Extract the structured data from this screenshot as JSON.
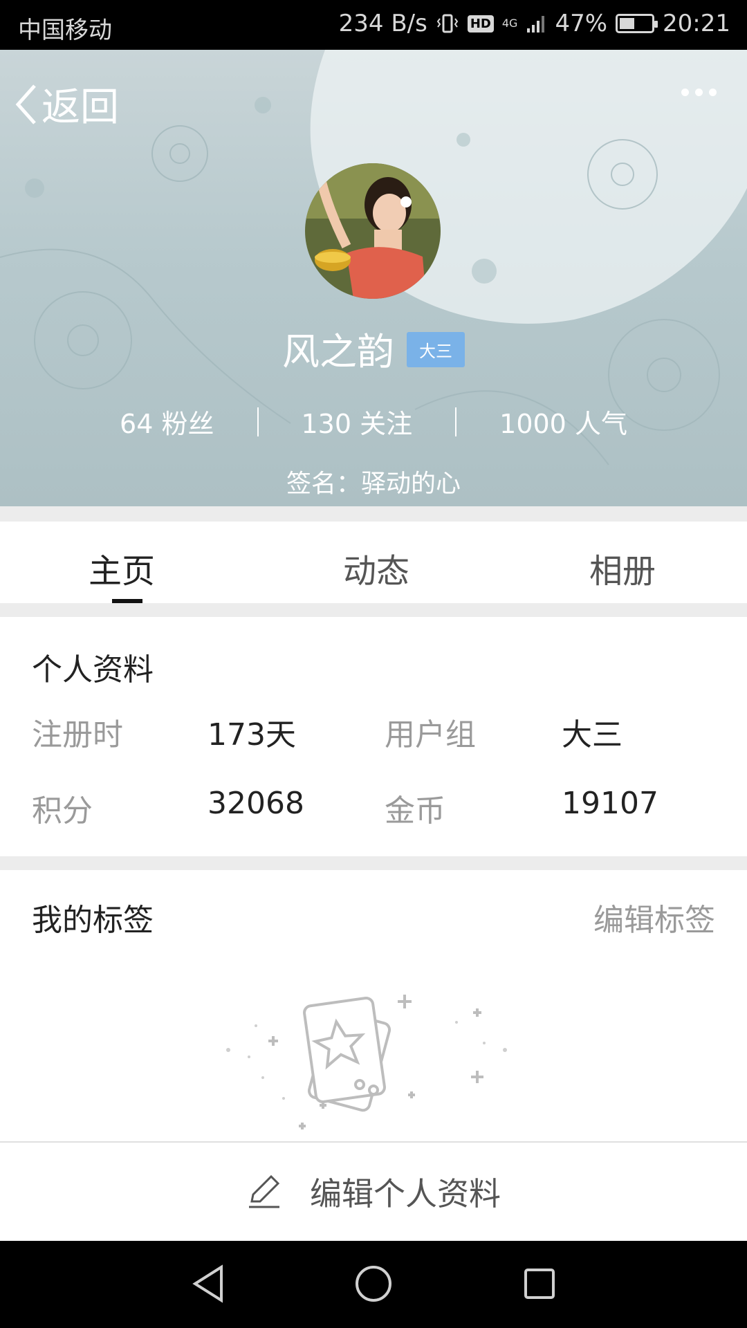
{
  "status_bar": {
    "carrier": "中国移动",
    "speed": "234 B/s",
    "hd": "HD",
    "network": "4G",
    "battery": "47%",
    "battery_level": 0.47,
    "time": "20:21"
  },
  "header": {
    "back_label": "返回",
    "username": "风之韵",
    "grade_badge": "大三",
    "stats": [
      {
        "value": "64",
        "label": "粉丝"
      },
      {
        "value": "130",
        "label": "关注"
      },
      {
        "value": "1000",
        "label": "人气"
      }
    ],
    "signature_label": "签名：",
    "signature": "驿动的心"
  },
  "tabs": [
    {
      "label": "主页",
      "active": true
    },
    {
      "label": "动态",
      "active": false
    },
    {
      "label": "相册",
      "active": false
    }
  ],
  "profile": {
    "title": "个人资料",
    "fields": [
      {
        "label": "注册时",
        "value": "173天"
      },
      {
        "label": "用户组",
        "value": "大三"
      },
      {
        "label": "积分",
        "value": "32068"
      },
      {
        "label": "金币",
        "value": "19107"
      }
    ]
  },
  "tags": {
    "title": "我的标签",
    "edit_label": "编辑标签"
  },
  "edit_bar": {
    "label": "编辑个人资料",
    "icon": "pencil-icon"
  },
  "nav_bar": {
    "icons": [
      "back-triangle-icon",
      "home-circle-icon",
      "recents-square-icon"
    ]
  },
  "colors": {
    "header_bg": "#b7c9cd",
    "badge_bg": "#7ab2e8",
    "label_gray": "#9a9a9a"
  }
}
